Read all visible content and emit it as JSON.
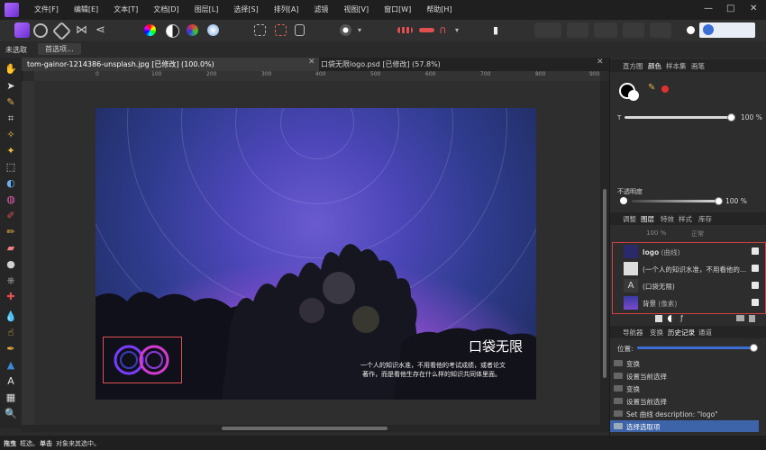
{
  "menu": {
    "items": [
      "文件[F]",
      "编辑[E]",
      "文本[T]",
      "文档[D]",
      "图层[L]",
      "选择[S]",
      "排列[A]",
      "滤镜",
      "视图[V]",
      "窗口[W]",
      "帮助[H]"
    ]
  },
  "window_controls": {
    "minimize": "—",
    "maximize": "□",
    "close": "✕"
  },
  "context_bar": {
    "status": "未选取",
    "button": "首选项..."
  },
  "tabs": [
    {
      "label": "tom-gainor-1214386-unsplash.jpg [已修改] (100.0%)",
      "active": true
    },
    {
      "label": "口袋无限logo.psd [已修改] (57.8%)",
      "active": false
    }
  ],
  "rulers": {
    "h_labels": [
      "0",
      "100",
      "200",
      "300",
      "400",
      "500",
      "600",
      "700",
      "800",
      "900"
    ]
  },
  "photo": {
    "title": "口袋无限",
    "sub_line1": "一个人的知识水准，不用看他的考试成绩，或者论文",
    "sub_line2": "著作，而是看他生存在什么样的知识共同体里面。"
  },
  "panel_top": {
    "tabs": [
      "直方图",
      "颜色",
      "样本集",
      "画笔"
    ],
    "active_tab": "颜色",
    "t_label": "T",
    "t_value": "100 %",
    "opacity_label": "不透明度",
    "opacity_value": "100 %"
  },
  "layers_panel": {
    "tabs": [
      "调整",
      "图层",
      "特效",
      "样式",
      "库存"
    ],
    "active_tab": "图层",
    "opacity": "100 %",
    "blend": "正常",
    "layers": [
      {
        "name": "logo",
        "type": "(曲线)"
      },
      {
        "name": "(一个人的知识水准，不用看他的...",
        "type": ""
      },
      {
        "name": "(口袋无限)",
        "type": ""
      },
      {
        "name": "背景",
        "type": "(像素)"
      }
    ]
  },
  "history_panel": {
    "tabs": [
      "导航器",
      "变换",
      "历史记录",
      "通道"
    ],
    "active_tab": "历史记录",
    "position_label": "位置:",
    "position_fraction": 0.98,
    "items": [
      {
        "label": "变换",
        "selected": false
      },
      {
        "label": "设置当前选择",
        "selected": false
      },
      {
        "label": "变换",
        "selected": false
      },
      {
        "label": "设置当前选择",
        "selected": false
      },
      {
        "label": "Set 曲线 description: \"logo\"",
        "selected": false
      },
      {
        "label": "选择选取项",
        "selected": true
      }
    ]
  },
  "status": {
    "text1": "拖曳",
    "text2": "框选。",
    "text3": "单击",
    "text4": "对象来其选中。"
  },
  "colors": {
    "accent": "#3b6fd6",
    "selection": "#3d63a8",
    "brand": "#9b4dff"
  }
}
